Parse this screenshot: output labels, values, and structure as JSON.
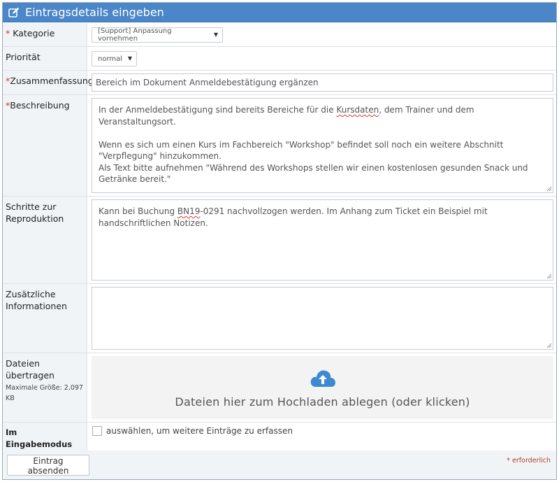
{
  "header": {
    "title": "Eintragsdetails eingeben",
    "icon": "edit-icon"
  },
  "fields": {
    "category": {
      "label": "Kategorie",
      "required_mark": "*",
      "value": "[Support] Anpassung vornehmen"
    },
    "priority": {
      "label": "Priorität",
      "value": "normal"
    },
    "summary": {
      "label": "Zusammenfassung",
      "required_mark": "*",
      "value": "Bereich im Dokument Anmeldebestätigung ergänzen"
    },
    "description": {
      "label": "Beschreibung",
      "required_mark": "*",
      "line1_a": "In der Anmeldebestätigung sind bereits Bereiche für die ",
      "line1_word": "Kursdaten",
      "line1_b": ", dem Trainer und dem Veranstaltungsort.",
      "para2": "Wenn es sich um einen Kurs im Fachbereich \"Workshop\" befindet soll noch ein weitere Abschnitt \"Verpflegung\" hinzukommen.",
      "para3": "Als Text bitte aufnehmen \"Während des Workshops stellen wir einen kostenlosen gesunden Snack und Getränke bereit.\""
    },
    "steps": {
      "label": "Schritte zur Reproduktion",
      "text_a": "Kann bei Buchung ",
      "text_word": "BN19",
      "text_b": "-0291 nachvollzogen werden. Im Anhang zum Ticket ein Beispiel mit handschriftlichen Notizen."
    },
    "additional": {
      "label": "Zusätzliche Informationen",
      "value": ""
    },
    "files": {
      "label": "Dateien übertragen",
      "max_size": "Maximale Größe: 2,097 KB",
      "dropzone_text": "Dateien hier zum Hochladen ablegen (oder klicken)",
      "icon": "cloud-upload-icon"
    },
    "stay": {
      "label": "Im Eingabemodus bleiben",
      "checkbox_label": "auswählen, um weitere Einträge zu erfassen",
      "checked": false
    }
  },
  "footer": {
    "submit_label": "Eintrag absenden",
    "required_note": "* erforderlich"
  },
  "colors": {
    "header_bg": "#4a86c8",
    "label_bg": "#f1f4f7",
    "required": "#c0392b"
  }
}
